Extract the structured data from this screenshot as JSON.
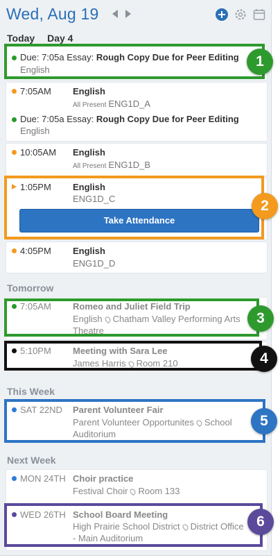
{
  "header": {
    "title": "Wed, Aug 19",
    "icons": [
      "chevron-left-icon",
      "chevron-right-icon",
      "add-icon",
      "gear-icon",
      "calendar-icon"
    ]
  },
  "today": {
    "label": "Today",
    "day": "Day 4",
    "items": [
      {
        "type": "due",
        "time": "Due: 7:05a",
        "prefix": "Essay:",
        "title": "Rough Copy Due for Peer Editing",
        "course": "English"
      },
      {
        "time": "7:05AM",
        "title": "English",
        "status": "All Present",
        "section": "ENG1D_A"
      },
      {
        "type": "due",
        "time": "Due: 7:05a",
        "prefix": "Essay:",
        "title": "Rough Copy Due for Peer Editing",
        "course": "English"
      },
      {
        "time": "10:05AM",
        "title": "English",
        "status": "All Present",
        "section": "ENG1D_B"
      },
      {
        "time": "1:05PM",
        "title": "English",
        "section": "ENG1D_C",
        "button": "Take Attendance"
      },
      {
        "time": "4:05PM",
        "title": "English",
        "section": "ENG1D_D"
      }
    ]
  },
  "tomorrow": {
    "label": "Tomorrow",
    "items": [
      {
        "time": "7:05AM",
        "title": "Romeo and Juliet Field Trip",
        "line1": "English",
        "loc1": "Chatham Valley Performing Arts",
        "loc2": "Theatre"
      },
      {
        "time": "5:10PM",
        "title": "Meeting with Sara Lee",
        "line1": "James Harris",
        "loc1": "Room 210"
      }
    ]
  },
  "this_week": {
    "label": "This Week",
    "items": [
      {
        "time": "SAT 22ND",
        "title": "Parent Volunteer Fair",
        "line1": "Parent Volunteer Opportunites",
        "loc1": "School",
        "loc2": "Auditorium"
      }
    ]
  },
  "next_week": {
    "label": "Next Week",
    "items": [
      {
        "time": "MON 24TH",
        "title": "Choir practice",
        "line1": "Festival Choir",
        "loc1": "Room 133"
      },
      {
        "time": "WED 26TH",
        "title": "School Board Meeting",
        "line1": "High Prairie School District",
        "loc1": "District Office",
        "loc2": "- Main Auditorium"
      }
    ]
  },
  "badges": [
    "1",
    "2",
    "3",
    "4",
    "5",
    "6"
  ],
  "colors": {
    "green": "#2e9a2e",
    "orange": "#f39a1f",
    "blue": "#2d74c3",
    "purple": "#5b4a9b",
    "black": "#111111",
    "dot_green": "#2a9a2a",
    "dot_orange": "#f39a1f",
    "dot_blue": "#2d7bd6",
    "dot_black": "#111111",
    "dot_purple": "#5b4a9b"
  }
}
